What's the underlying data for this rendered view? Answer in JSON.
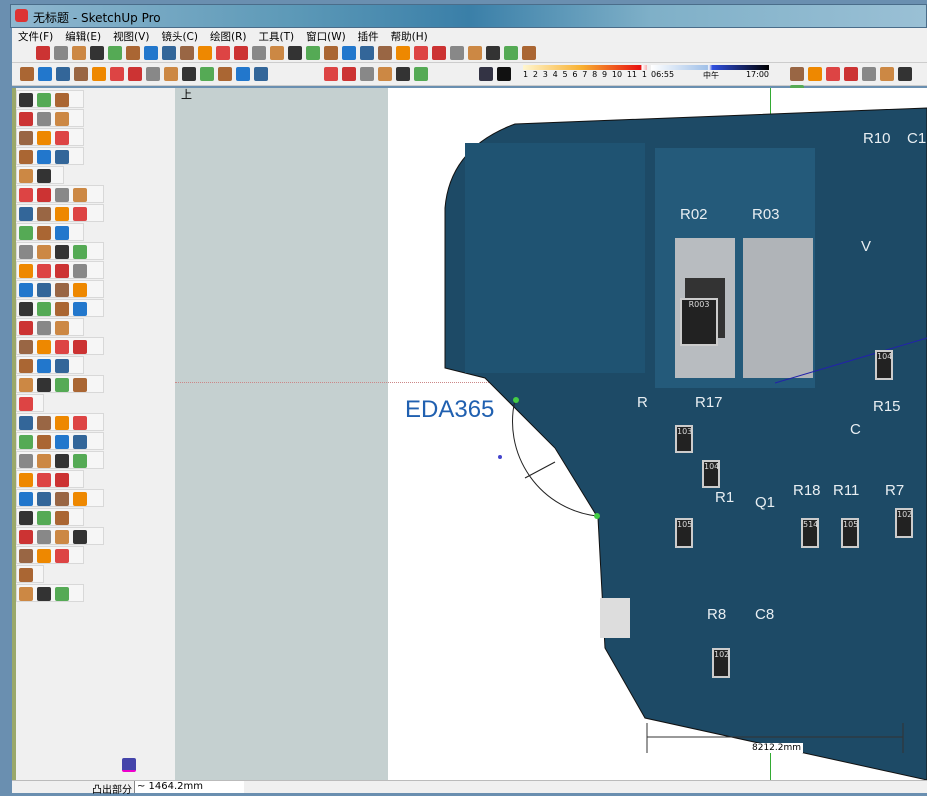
{
  "window": {
    "title": "无标题 - SketchUp Pro"
  },
  "menu": [
    "文件(F)",
    "编辑(E)",
    "视图(V)",
    "镜头(C)",
    "绘图(R)",
    "工具(T)",
    "窗口(W)",
    "插件",
    "帮助(H)"
  ],
  "shadow": {
    "months": [
      "1",
      "2",
      "3",
      "4",
      "5",
      "6",
      "7",
      "8",
      "9",
      "10",
      "11",
      "1"
    ],
    "time_start": "06:55",
    "time_mid": "中午",
    "time_end": "17:00"
  },
  "viewport": {
    "view_label": "上",
    "watermark": "EDA365",
    "dimension": "8212.2mm",
    "pcb_labels": [
      "R02",
      "R03",
      "R10",
      "C1",
      "R",
      "R17",
      "R1",
      "Q1",
      "R18",
      "R11",
      "R7",
      "R8",
      "C8",
      "R15",
      "V",
      "C"
    ],
    "component_marks": [
      "R003",
      "103",
      "104",
      "105",
      "514",
      "105",
      "102",
      "102",
      "104"
    ]
  },
  "status": {
    "label": "凸出部分",
    "value": "~ 1464.2mm"
  },
  "colors": {
    "pcb": "#1d4a66",
    "board_edge": "#0f2f45"
  }
}
